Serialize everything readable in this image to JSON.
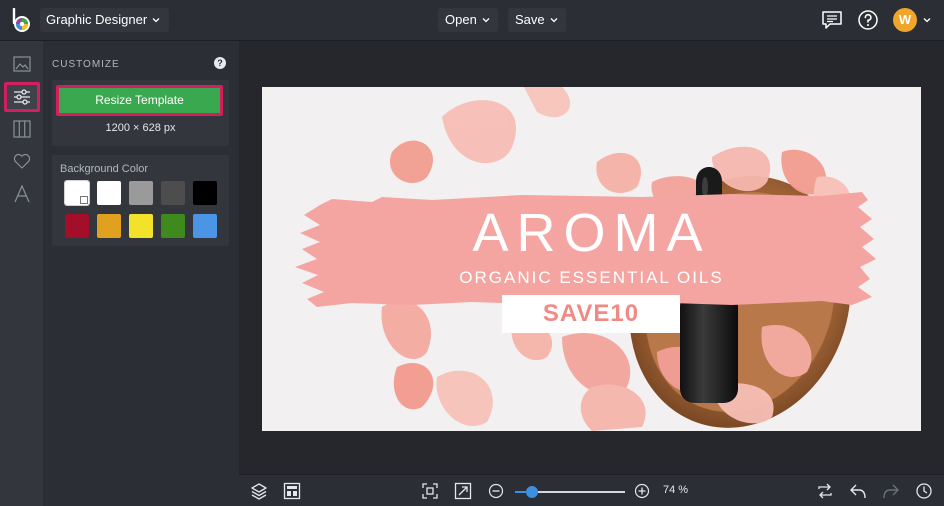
{
  "topbar": {
    "app_name": "Graphic Designer",
    "open_label": "Open",
    "save_label": "Save",
    "user_initial": "W"
  },
  "rail": {
    "items": [
      {
        "icon": "image-icon",
        "active": false
      },
      {
        "icon": "sliders-icon",
        "active": true
      },
      {
        "icon": "layout-icon",
        "active": false
      },
      {
        "icon": "heart-icon",
        "active": false
      },
      {
        "icon": "text-icon",
        "active": false
      }
    ]
  },
  "panel": {
    "title": "CUSTOMIZE",
    "help": "?",
    "resize_label": "Resize Template",
    "dimensions": "1200 × 628 px",
    "bg_label": "Background Color",
    "swatches": [
      "#ffffff",
      "#ffffff",
      "#9a9a9a",
      "#4d4d4d",
      "#000000",
      "#a30e2b",
      "#e0a21e",
      "#f2e22a",
      "#3f8a1e",
      "#4a95e6"
    ]
  },
  "canvas": {
    "headline": "AROMA",
    "subline": "ORGANIC ESSENTIAL OILS",
    "code": "SAVE10",
    "brush_color": "#f4a5a2",
    "code_color": "#f08a85"
  },
  "bottombar": {
    "zoom": "74 %",
    "zoom_fraction": 0.15
  }
}
